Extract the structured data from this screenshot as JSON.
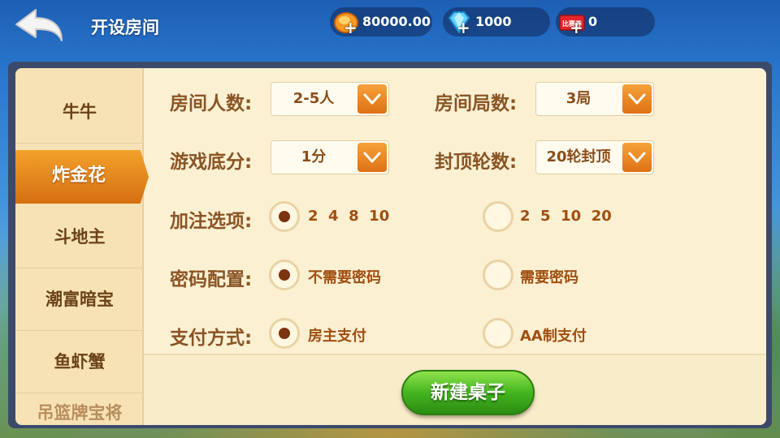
{
  "header": {
    "title": "开设房间",
    "gold": "80000.00",
    "diamonds": "1000",
    "tickets": "0",
    "ticket_icon_text": "比赛券"
  },
  "sidebar": {
    "items": [
      "牛牛",
      "炸金花",
      "斗地主",
      "潮富暗宝",
      "鱼虾蟹",
      "...宝..."
    ],
    "active": "炸金花",
    "partial_item": "吊篮牌宝将"
  },
  "form": {
    "players": {
      "label": "房间人数:",
      "value": "2-5人"
    },
    "rounds": {
      "label": "房间局数:",
      "value": "3局"
    },
    "base_score": {
      "label": "游戏底分:",
      "value": "1分"
    },
    "cap": {
      "label": "封顶轮数:",
      "value": "20轮封顶"
    },
    "bet_options": {
      "label": "加注选项:",
      "options": [
        "2  4  8  10",
        "2  5  10  20"
      ],
      "selected": 0
    },
    "password": {
      "label": "密码配置:",
      "options": [
        "不需要密码",
        "需要密码"
      ],
      "selected": 0
    },
    "payment": {
      "label": "支付方式:",
      "options": [
        "房主支付",
        "AA制支付"
      ],
      "selected": 0
    }
  },
  "actions": {
    "create_label": "新建桌子"
  },
  "colors": {
    "accent_orange": "#e8851e",
    "label_brown": "#8a5526",
    "button_green": "#45b520"
  }
}
